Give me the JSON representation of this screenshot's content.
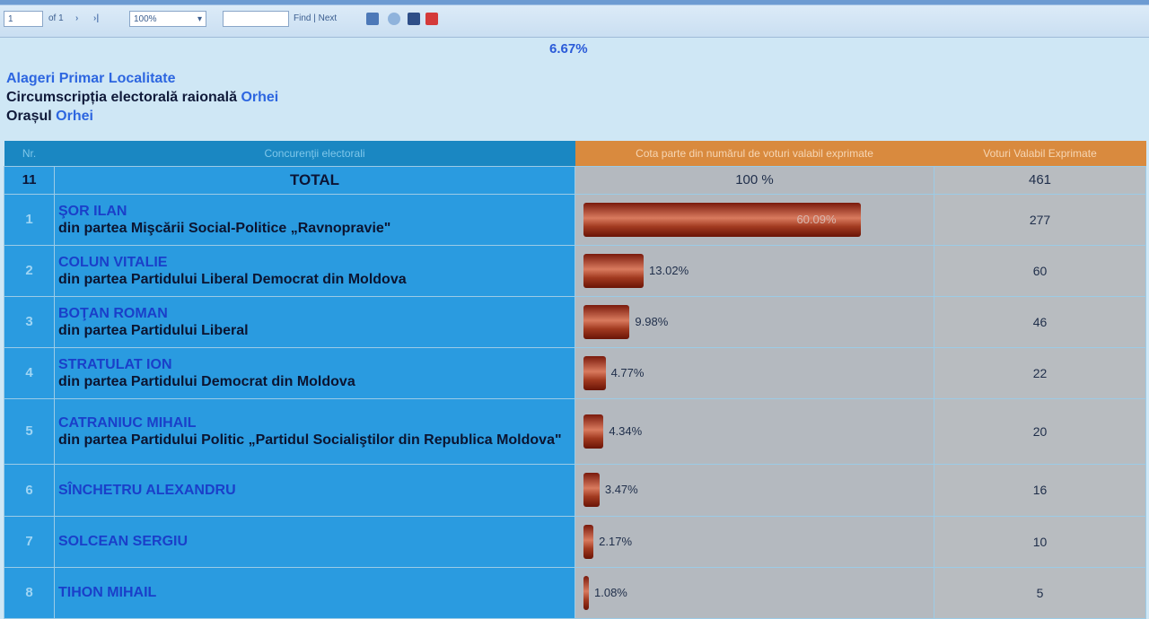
{
  "toolbar": {
    "page_input": "1",
    "page_of": "of 1",
    "zoom": "100%",
    "find_value": "",
    "find_label": "Find | Next"
  },
  "top_percent": "6.67%",
  "header": {
    "title": "Alageri Primar Localitate",
    "circ_label": "Circumscripția electorală raională",
    "circ_value": "Orhei",
    "city_label": "Orașul",
    "city_value": "Orhei"
  },
  "table": {
    "columns": [
      "Nr.",
      "Concurenţii electorali",
      "Cota parte din numărul de voturi valabil exprimate",
      "Voturi Valabil Exprimate"
    ],
    "total": {
      "nr": "11",
      "label": "TOTAL",
      "percent": "100 %",
      "votes": "461"
    },
    "rows": [
      {
        "nr": "1",
        "name": "ŞOR ILAN",
        "party": "din partea Mişcării Social-Politice „Ravnopravie\"",
        "percent": 60.09,
        "percent_label": "60.09%",
        "votes": "277"
      },
      {
        "nr": "2",
        "name": "COLUN VITALIE",
        "party": "din partea Partidului Liberal Democrat din Moldova",
        "percent": 13.02,
        "percent_label": "13.02%",
        "votes": "60"
      },
      {
        "nr": "3",
        "name": "BOŢAN ROMAN",
        "party": "din partea Partidului Liberal",
        "percent": 9.98,
        "percent_label": "9.98%",
        "votes": "46"
      },
      {
        "nr": "4",
        "name": "STRATULAT ION",
        "party": "din partea Partidului Democrat din Moldova",
        "percent": 4.77,
        "percent_label": "4.77%",
        "votes": "22"
      },
      {
        "nr": "5",
        "name": "CATRANIUC MIHAIL",
        "party": "din partea Partidului Politic „Partidul Socialiştilor din Republica Moldova\"",
        "percent": 4.34,
        "percent_label": "4.34%",
        "votes": "20"
      },
      {
        "nr": "6",
        "name": "SÎNCHETRU ALEXANDRU",
        "party": "",
        "percent": 3.47,
        "percent_label": "3.47%",
        "votes": "16"
      },
      {
        "nr": "7",
        "name": "SOLCEAN SERGIU",
        "party": "",
        "percent": 2.17,
        "percent_label": "2.17%",
        "votes": "10"
      },
      {
        "nr": "8",
        "name": "TIHON MIHAIL",
        "party": "",
        "percent": 1.08,
        "percent_label": "1.08%",
        "votes": "5"
      }
    ]
  },
  "colors": {
    "bar": "#b0402a",
    "name_cell": "#2a9be0",
    "header_blue": "#1a87c2",
    "header_orange": "#d98a3e"
  }
}
